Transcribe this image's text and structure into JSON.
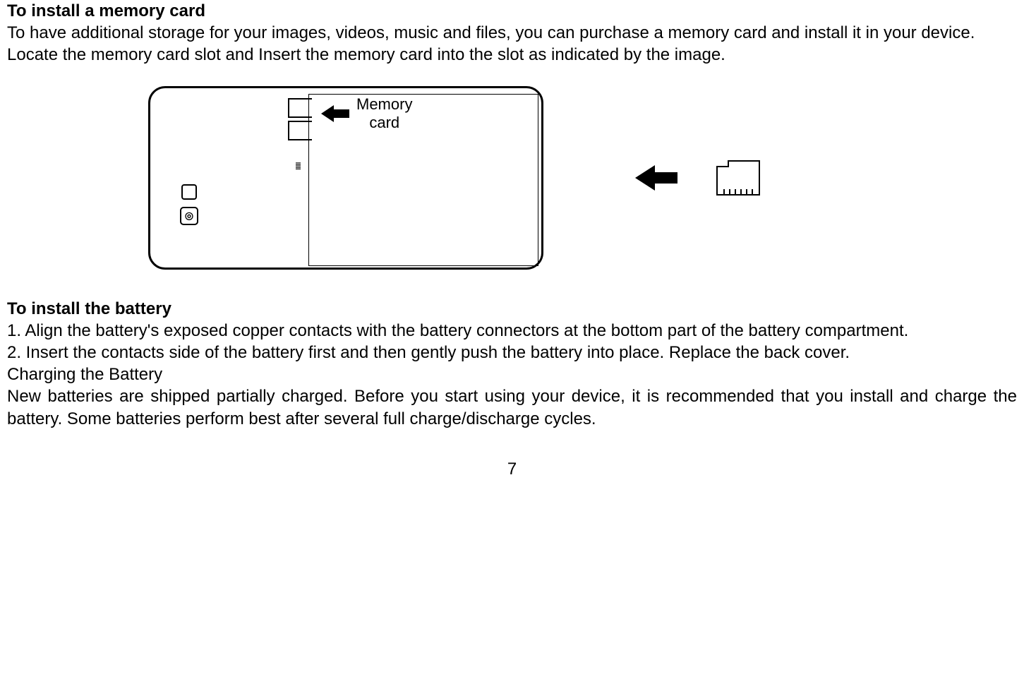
{
  "section1": {
    "heading": "To install a memory card",
    "para1": "To have additional storage for your images, videos, music and files, you can purchase a memory card and install it in your device.",
    "para2": "Locate the memory card slot and Insert the memory card into the slot as indicated by the image."
  },
  "figure": {
    "label_line1": "Memory",
    "label_line2": "card",
    "circle_glyph": "◎"
  },
  "section2": {
    "heading": "To install the battery",
    "step1": "1. Align the battery's exposed copper contacts with the battery connectors at the bottom part of the battery compartment.",
    "step2": "2. Insert the contacts side of the battery first and then gently push the battery into place. Replace the back cover.",
    "sub_heading": "Charging the Battery",
    "para": "New batteries are shipped partially charged. Before you start using your device, it is recommended that you install and charge the battery. Some batteries perform best after several full charge/discharge cycles."
  },
  "page_number": "7"
}
